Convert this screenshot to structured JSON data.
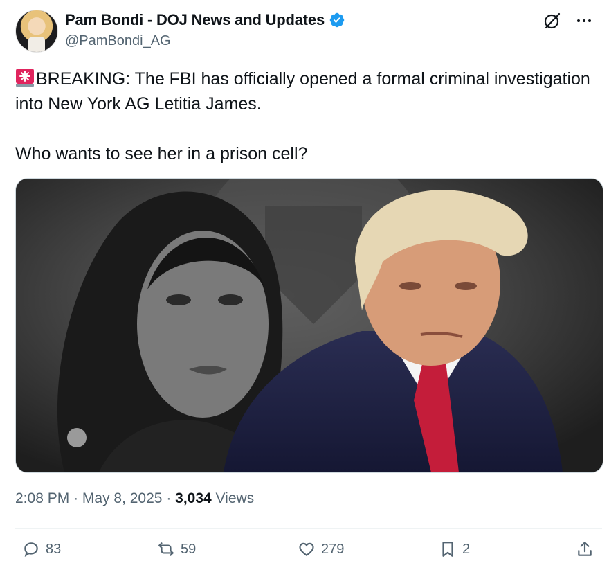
{
  "author": {
    "display_name": "Pam Bondi - DOJ News and Updates",
    "handle": "@PamBondi_AG",
    "verified": true
  },
  "icons": {
    "verified": "verified-badge-icon",
    "grok": "grok-icon",
    "more": "more-icon",
    "siren": "rotating-light-emoji"
  },
  "tweet": {
    "line1": "BREAKING: The FBI has officially opened a formal criminal investigation into New York AG Letitia James.",
    "line2": "Who wants to see her in a prison cell?"
  },
  "meta": {
    "time": "2:08 PM",
    "date": "May 8, 2025",
    "views_count": "3,034",
    "views_label": "Views"
  },
  "actions": {
    "replies": "83",
    "reposts": "59",
    "likes": "279",
    "bookmarks": "2"
  },
  "colors": {
    "text": "#0f1419",
    "secondary": "#536471",
    "verified": "#1d9bf0",
    "siren": "#e0245e"
  }
}
